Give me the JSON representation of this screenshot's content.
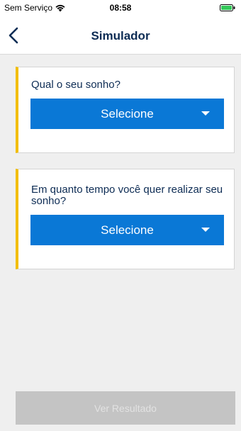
{
  "status_bar": {
    "carrier": "Sem Serviço",
    "time": "08:58",
    "wifi_icon": "wifi-icon",
    "battery_icon": "battery-icon",
    "battery_color": "#34c759"
  },
  "nav": {
    "back_icon": "chevron-left-icon",
    "title": "Simulador",
    "title_color": "#0d2c54"
  },
  "cards": [
    {
      "question": "Qual o seu sonho?",
      "select_value": "Selecione",
      "caret_icon": "caret-down-icon"
    },
    {
      "question": "Em quanto tempo você quer realizar seu sonho?",
      "select_value": "Selecione",
      "caret_icon": "caret-down-icon"
    }
  ],
  "result_button": {
    "label": "Ver Resultado",
    "state": "disabled"
  },
  "colors": {
    "accent_blue": "#0a78d6",
    "card_marker_yellow": "#f2be00",
    "background": "#efefef",
    "disabled_button": "#c4c4c4"
  }
}
